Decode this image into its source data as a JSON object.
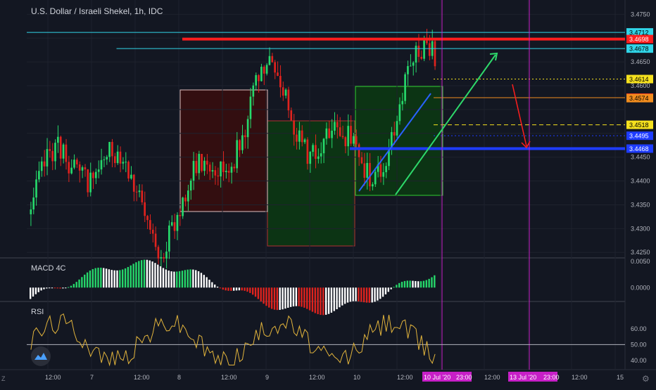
{
  "header": {
    "title": "U.S. Dollar / Israeli Shekel, 1h, IDC"
  },
  "panes": {
    "macd_label": "MACD 4C",
    "rsi_label": "RSI"
  },
  "side_icons": {
    "left_z": "Z",
    "right_gear": "⚙"
  },
  "colors": {
    "bg": "#131722",
    "grid": "#1e222d",
    "axis_text": "#b2b5be",
    "up": "#26d96b",
    "down": "#e0231e",
    "rsi": "#e2b43c",
    "cyan": "#30d5e8",
    "red": "#ff1e1e",
    "yellow": "#f5e11e",
    "orange": "#f08c1e",
    "blue": "#1e3cff",
    "magenta": "#c71fc7",
    "box_dark_red": "#3a0d0d",
    "box_dark_green": "#0c3a12"
  },
  "chart_data": [
    {
      "type": "candlestick",
      "title": "U.S. Dollar / Israeli Shekel, 1h, IDC",
      "y_axis_ticks": [
        3.475,
        3.47,
        3.465,
        3.46,
        3.455,
        3.45,
        3.445,
        3.44,
        3.435,
        3.43,
        3.425
      ],
      "y_axis_labels": [
        "3.4750",
        "3.4650",
        "3.4600",
        "3.4450",
        "3.4400",
        "3.4350",
        "3.4300",
        "3.4250"
      ],
      "ylim": [
        3.424,
        3.478
      ],
      "price_labels": [
        {
          "value": "3.4712",
          "color": "#30d5e8"
        },
        {
          "value": "3.4698",
          "color": "#ff1e1e"
        },
        {
          "value": "3.4678",
          "color": "#30d5e8"
        },
        {
          "value": "3.4614",
          "color": "#f5e11e"
        },
        {
          "value": "3.4575",
          "color": "#ff1e1e"
        },
        {
          "value": "3.4574",
          "color": "#f08c1e"
        },
        {
          "value": "3.4518",
          "color": "#f5e11e"
        },
        {
          "value": "3.4495",
          "color": "#1e3cff"
        },
        {
          "value": "3.4468",
          "color": "#1e3cff"
        }
      ],
      "horizontal_lines": [
        {
          "price": 3.4712,
          "style": "solid",
          "color": "#30d5e8",
          "x_from": 0.0
        },
        {
          "price": 3.4698,
          "style": "thick",
          "color": "#ff1e1e",
          "x_from": 0.26
        },
        {
          "price": 3.4678,
          "style": "solid",
          "color": "#30d5e8",
          "x_from": 0.15
        },
        {
          "price": 3.4614,
          "style": "dotted",
          "color": "#f5e11e",
          "x_from": 0.68
        },
        {
          "price": 3.4575,
          "style": "solid",
          "color": "#f08c1e",
          "x_from": 0.68
        },
        {
          "price": 3.4518,
          "style": "dashed",
          "color": "#f5e11e",
          "x_from": 0.68
        },
        {
          "price": 3.4495,
          "style": "dotted",
          "color": "#1e3cff",
          "x_from": 0.68
        },
        {
          "price": 3.4468,
          "style": "thick",
          "color": "#1e3cff",
          "x_from": 0.54
        }
      ],
      "candles_seed": 37,
      "candle_count": 150,
      "price_start": 3.433,
      "price_end": 3.459,
      "x_tick_labels": [
        "12:00",
        "7",
        "12:00",
        "8",
        "12:00",
        "9",
        "12:00",
        "10",
        "12:00",
        "10 Jul '20",
        "23:00",
        "12:00",
        "13 Jul '20",
        "23:00",
        "12:00",
        "15"
      ],
      "highlighted_dates": [
        "10 Jul '20   23:00",
        "13 Jul '20   23:00"
      ]
    },
    {
      "type": "bar",
      "title": "MACD 4C",
      "y_axis_labels": [
        "0.0050",
        "0.0000"
      ],
      "ylim": [
        -0.0025,
        0.0055
      ]
    },
    {
      "type": "line",
      "title": "RSI",
      "y_axis_labels": [
        "60.00",
        "50.00",
        "40.00"
      ],
      "ylim": [
        35,
        77
      ],
      "reference_line": 50
    }
  ]
}
